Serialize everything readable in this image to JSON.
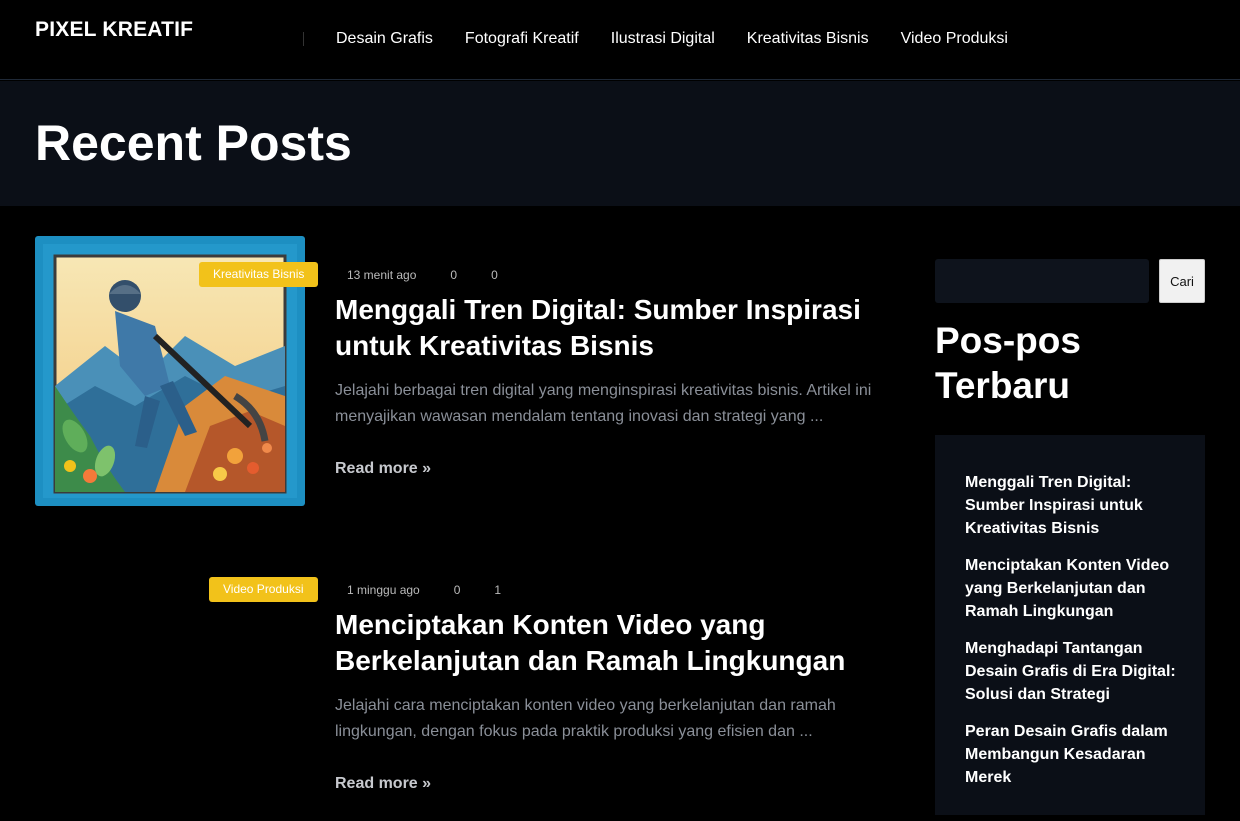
{
  "header": {
    "brand": "PIXEL KREATIF",
    "nav": [
      "Desain Grafis",
      "Fotografi Kreatif",
      "Ilustrasi Digital",
      "Kreativitas Bisnis",
      "Video Produksi"
    ]
  },
  "page": {
    "title": "Recent Posts"
  },
  "posts": [
    {
      "category": "Kreativitas Bisnis",
      "time": "13 menit ago",
      "views": "0",
      "comments": "0",
      "title": "Menggali Tren Digital: Sumber Inspirasi untuk Kreativitas Bisnis",
      "excerpt": "Jelajahi berbagai tren digital yang menginspirasi kreativitas bisnis. Artikel ini menyajikan wawasan mendalam tentang inovasi dan strategi yang ...",
      "read_more": "Read more »"
    },
    {
      "category": "Video Produksi",
      "time": "1 minggu ago",
      "views": "0",
      "comments": "1",
      "title": "Menciptakan Konten Video yang Berkelanjutan dan Ramah Lingkungan",
      "excerpt": "Jelajahi cara menciptakan konten video yang berkelanjutan dan ramah lingkungan, dengan fokus pada praktik produksi yang efisien dan ...",
      "read_more": "Read more »"
    }
  ],
  "sidebar": {
    "search": {
      "value": "",
      "placeholder": "",
      "button": "Cari"
    },
    "widget_title": "Pos-pos Terbaru",
    "recent": [
      "Menggali Tren Digital: Sumber Inspirasi untuk Kreativitas Bisnis",
      "Menciptakan Konten Video yang Berkelanjutan dan Ramah Lingkungan",
      "Menghadapi Tantangan Desain Grafis di Era Digital: Solusi dan Strategi",
      "Peran Desain Grafis dalam Membangun Kesadaran Merek"
    ]
  },
  "colors": {
    "accent_badge": "#f2c21a",
    "background": "#000000",
    "panel": "#0b0f17"
  }
}
